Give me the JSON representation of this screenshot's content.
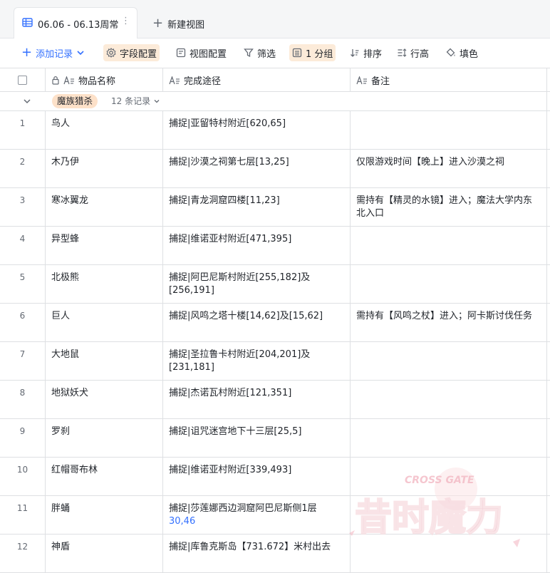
{
  "tabs": {
    "active_label": "06.06 - 06.13周常",
    "new_view_label": "新建视图"
  },
  "toolbar": {
    "add_record": "添加记录",
    "field_config": "字段配置",
    "view_config": "视图配置",
    "filter": "筛选",
    "group": "1 分组",
    "sort": "排序",
    "row_height": "行高",
    "fill": "填色"
  },
  "columns": {
    "name": "物品名称",
    "path": "完成途径",
    "note": "备注"
  },
  "group": {
    "tag": "魔族猎杀",
    "count": "12 条记录"
  },
  "rows": [
    {
      "idx": "1",
      "name": "鸟人",
      "path": "捕捉|亚留特村附近[620,65]",
      "path_link": "",
      "note": ""
    },
    {
      "idx": "2",
      "name": "木乃伊",
      "path": "捕捉|沙漠之祠第七层[13,25]",
      "path_link": "",
      "note": "仅限游戏时间【晚上】进入沙漠之祠"
    },
    {
      "idx": "3",
      "name": "寒冰翼龙",
      "path": "捕捉|青龙洞窟四楼[11,23]",
      "path_link": "",
      "note": "需持有【精灵的水镜】进入；魔法大学内东北入口"
    },
    {
      "idx": "4",
      "name": "异型蜂",
      "path": "捕捉|维诺亚村附近[471,395]",
      "path_link": "",
      "note": ""
    },
    {
      "idx": "5",
      "name": "北极熊",
      "path": "捕捉|阿巴尼斯村附近[255,182]及[256,191]",
      "path_link": "",
      "note": ""
    },
    {
      "idx": "6",
      "name": "巨人",
      "path": "捕捉|风鸣之塔十楼[14,62]及[15,62]",
      "path_link": "",
      "note": "需持有【风鸣之杖】进入；阿卡斯讨伐任务"
    },
    {
      "idx": "7",
      "name": "大地鼠",
      "path": "捕捉|圣拉鲁卡村附近[204,201]及[231,181]",
      "path_link": "",
      "note": ""
    },
    {
      "idx": "8",
      "name": "地狱妖犬",
      "path": "捕捉|杰诺瓦村附近[121,351]",
      "path_link": "",
      "note": ""
    },
    {
      "idx": "9",
      "name": "罗刹",
      "path": "捕捉|诅咒迷宫地下十三层[25,5]",
      "path_link": "",
      "note": ""
    },
    {
      "idx": "10",
      "name": "红帽哥布林",
      "path": "捕捉|维诺亚村附近[339,493]",
      "path_link": "",
      "note": ""
    },
    {
      "idx": "11",
      "name": "胖蛹",
      "path": "捕捉|莎莲娜西边洞窟阿巴尼斯侧1层",
      "path_link": "30,46",
      "note": ""
    },
    {
      "idx": "12",
      "name": "神盾",
      "path": "捕捉|库鲁克斯岛【731.672】米村出去",
      "path_link": "",
      "note": ""
    }
  ],
  "watermark": {
    "text_cn": "昔时魔力",
    "text_en": "CROSS GATE"
  }
}
